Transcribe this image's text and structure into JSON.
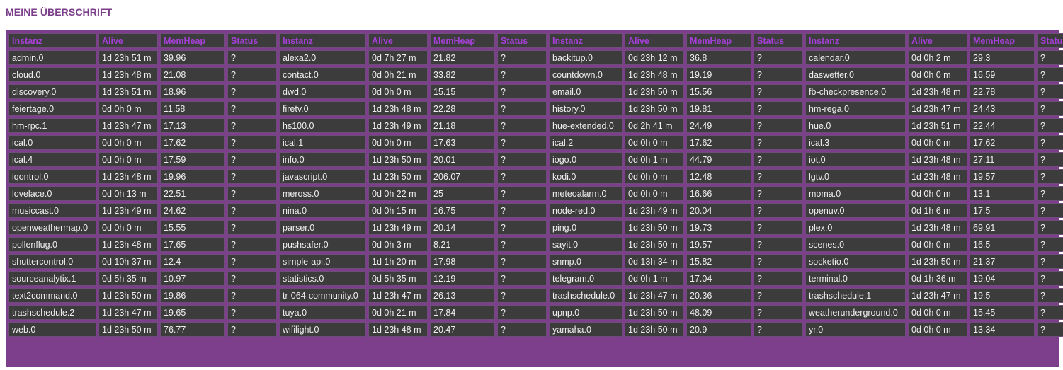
{
  "title": "MEINE ÜBERSCHRIFT",
  "columns": [
    "Instanz",
    "Alive",
    "MemHeap",
    "Status",
    "Instanz",
    "Alive",
    "MemHeap",
    "Status",
    "Instanz",
    "Alive",
    "MemHeap",
    "Status",
    "Instanz",
    "Alive",
    "MemHeap",
    "Status"
  ],
  "rows": [
    [
      "admin.0",
      "1d 23h 51 m",
      "39.96",
      "?",
      "alexa2.0",
      "0d 7h 27 m",
      "21.82",
      "?",
      "backitup.0",
      "0d 23h 12 m",
      "36.8",
      "?",
      "calendar.0",
      "0d 0h 2 m",
      "29.3",
      "?"
    ],
    [
      "cloud.0",
      "1d 23h 48 m",
      "21.08",
      "?",
      "contact.0",
      "0d 0h 21 m",
      "33.82",
      "?",
      "countdown.0",
      "1d 23h 48 m",
      "19.19",
      "?",
      "daswetter.0",
      "0d 0h 0 m",
      "16.59",
      "?"
    ],
    [
      "discovery.0",
      "1d 23h 51 m",
      "18.96",
      "?",
      "dwd.0",
      "0d 0h 0 m",
      "15.15",
      "?",
      "email.0",
      "1d 23h 50 m",
      "15.56",
      "?",
      "fb-checkpresence.0",
      "1d 23h 48 m",
      "22.78",
      "?"
    ],
    [
      "feiertage.0",
      "0d 0h 0 m",
      "11.58",
      "?",
      "firetv.0",
      "1d 23h 48 m",
      "22.28",
      "?",
      "history.0",
      "1d 23h 50 m",
      "19.81",
      "?",
      "hm-rega.0",
      "1d 23h 47 m",
      "24.43",
      "?"
    ],
    [
      "hm-rpc.1",
      "1d 23h 47 m",
      "17.13",
      "?",
      "hs100.0",
      "1d 23h 49 m",
      "21.18",
      "?",
      "hue-extended.0",
      "0d 2h 41 m",
      "24.49",
      "?",
      "hue.0",
      "1d 23h 51 m",
      "22.44",
      "?"
    ],
    [
      "ical.0",
      "0d 0h 0 m",
      "17.62",
      "?",
      "ical.1",
      "0d 0h 0 m",
      "17.63",
      "?",
      "ical.2",
      "0d 0h 0 m",
      "17.62",
      "?",
      "ical.3",
      "0d 0h 0 m",
      "17.62",
      "?"
    ],
    [
      "ical.4",
      "0d 0h 0 m",
      "17.59",
      "?",
      "info.0",
      "1d 23h 50 m",
      "20.01",
      "?",
      "iogo.0",
      "0d 0h 1 m",
      "44.79",
      "?",
      "iot.0",
      "1d 23h 48 m",
      "27.11",
      "?"
    ],
    [
      "iqontrol.0",
      "1d 23h 48 m",
      "19.96",
      "?",
      "javascript.0",
      "1d 23h 50 m",
      "206.07",
      "?",
      "kodi.0",
      "0d 0h 0 m",
      "12.48",
      "?",
      "lgtv.0",
      "1d 23h 48 m",
      "19.57",
      "?"
    ],
    [
      "lovelace.0",
      "0d 0h 13 m",
      "22.51",
      "?",
      "meross.0",
      "0d 0h 22 m",
      "25",
      "?",
      "meteoalarm.0",
      "0d 0h 0 m",
      "16.66",
      "?",
      "moma.0",
      "0d 0h 0 m",
      "13.1",
      "?"
    ],
    [
      "musiccast.0",
      "1d 23h 49 m",
      "24.62",
      "?",
      "nina.0",
      "0d 0h 15 m",
      "16.75",
      "?",
      "node-red.0",
      "1d 23h 49 m",
      "20.04",
      "?",
      "openuv.0",
      "0d 1h 6 m",
      "17.5",
      "?"
    ],
    [
      "openweathermap.0",
      "0d 0h 0 m",
      "15.55",
      "?",
      "parser.0",
      "1d 23h 49 m",
      "20.14",
      "?",
      "ping.0",
      "1d 23h 50 m",
      "19.73",
      "?",
      "plex.0",
      "1d 23h 48 m",
      "69.91",
      "?"
    ],
    [
      "pollenflug.0",
      "1d 23h 48 m",
      "17.65",
      "?",
      "pushsafer.0",
      "0d 0h 3 m",
      "8.21",
      "?",
      "sayit.0",
      "1d 23h 50 m",
      "19.57",
      "?",
      "scenes.0",
      "0d 0h 0 m",
      "16.5",
      "?"
    ],
    [
      "shuttercontrol.0",
      "0d 10h 37 m",
      "12.4",
      "?",
      "simple-api.0",
      "1d 1h 20 m",
      "17.98",
      "?",
      "snmp.0",
      "0d 13h 34 m",
      "15.82",
      "?",
      "socketio.0",
      "1d 23h 50 m",
      "21.37",
      "?"
    ],
    [
      "sourceanalytix.1",
      "0d 5h 35 m",
      "10.97",
      "?",
      "statistics.0",
      "0d 5h 35 m",
      "12.19",
      "?",
      "telegram.0",
      "0d 0h 1 m",
      "17.04",
      "?",
      "terminal.0",
      "0d 1h 36 m",
      "19.04",
      "?"
    ],
    [
      "text2command.0",
      "1d 23h 50 m",
      "19.86",
      "?",
      "tr-064-community.0",
      "1d 23h 47 m",
      "26.13",
      "?",
      "trashschedule.0",
      "1d 23h 47 m",
      "20.36",
      "?",
      "trashschedule.1",
      "1d 23h 47 m",
      "19.5",
      "?"
    ],
    [
      "trashschedule.2",
      "1d 23h 47 m",
      "19.65",
      "?",
      "tuya.0",
      "0d 0h 21 m",
      "17.84",
      "?",
      "upnp.0",
      "1d 23h 50 m",
      "48.09",
      "?",
      "weatherunderground.0",
      "0d 0h 0 m",
      "15.45",
      "?"
    ],
    [
      "web.0",
      "1d 23h 50 m",
      "76.77",
      "?",
      "wifilight.0",
      "1d 23h 48 m",
      "20.47",
      "?",
      "yamaha.0",
      "1d 23h 50 m",
      "20.9",
      "?",
      "yr.0",
      "0d 0h 0 m",
      "13.34",
      "?"
    ]
  ]
}
